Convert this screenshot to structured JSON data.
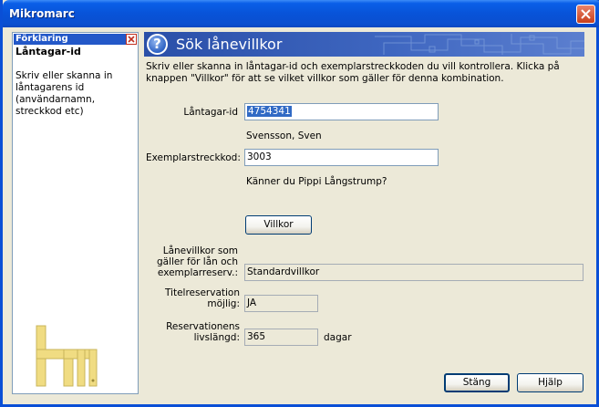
{
  "window": {
    "title": "Mikromarc"
  },
  "sidebar": {
    "header": "Förklaring",
    "title": "Låntagar-id",
    "description": "Skriv eller skanna in låntagarens id (användarnamn, streckkod etc)"
  },
  "header": {
    "title": "Sök lånevillkor",
    "help_icon": "?"
  },
  "intro": "Skriv eller skanna in låntagar-id och exemplarstreckkoden du vill kontrollera. Klicka på knappen \"Villkor\" för att se vilket villkor som gäller för denna kombination.",
  "form": {
    "borrower_label": "Låntagar-id",
    "borrower_value": "4754341",
    "borrower_name": "Svensson, Sven",
    "item_label": "Exemplarstreckkod:",
    "item_value": "3003",
    "item_title": "Känner du Pippi Långstrump?",
    "villkor_button": "Villkor",
    "terms_label_1": "Lånevillkor som",
    "terms_label_2": "gäller för lån och",
    "terms_label_3": "exemplarreserv.:",
    "terms_value": "Standardvillkor",
    "title_res_label_1": "Titelreservation",
    "title_res_label_2": "möjlig:",
    "title_res_value": "JA",
    "res_life_label_1": "Reservationens",
    "res_life_label_2": "livslängd:",
    "res_life_value": "365",
    "res_life_unit": "dagar"
  },
  "footer": {
    "close_button": "Stäng",
    "help_button": "Hjälp"
  },
  "colors": {
    "titlebar": "#0a5fe8",
    "header_band": "#3e66c0",
    "selection": "#316ac5",
    "logo": "#f0dc82"
  }
}
